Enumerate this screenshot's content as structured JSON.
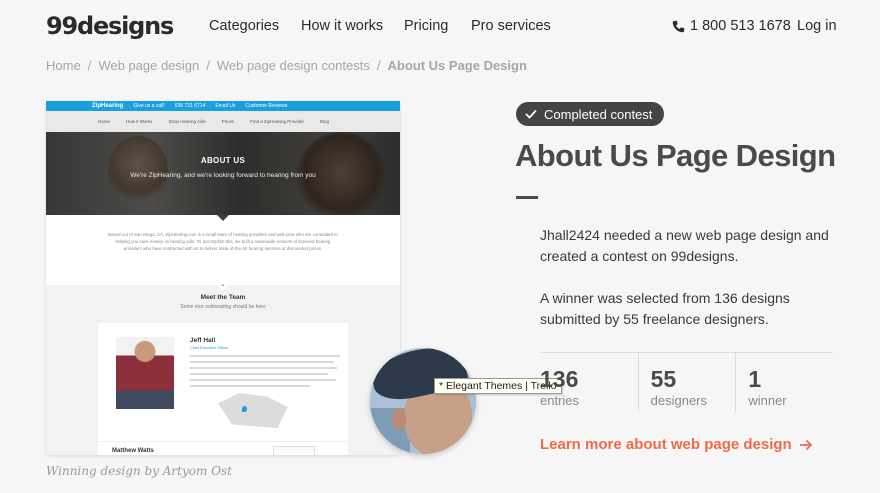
{
  "header": {
    "logo": "99designs",
    "nav": [
      "Categories",
      "How it works",
      "Pricing",
      "Pro services"
    ],
    "phone": "1 800 513 1678",
    "login": "Log in"
  },
  "breadcrumb": [
    "Home",
    "Web page design",
    "Web page design contests",
    "About Us Page Design"
  ],
  "preview": {
    "brand": "ZipHearing",
    "topbar": [
      "Give us a call!",
      "636 721 6714",
      "Email Us",
      "Customer Reviews"
    ],
    "nav": [
      "Home",
      "How it Works",
      "Shop Hearing Aids",
      "Prices",
      "Find a ZipHearing Provider",
      "Blog"
    ],
    "hero_title": "ABOUT US",
    "hero_subtitle": "We're ZipHearing, and we're looking forward to hearing from you",
    "intro": "Based out of San Diego, CA, ZipHearing.com is a small team of hearing providers and web pros who are committed to helping you save money on hearing aids. To accomplish this, we built a nationwide network of licensed hearing providers who have contracted with us to deliver state-of-the-art hearing services at discounted prices.",
    "team_title": "Meet the Team",
    "team_subtitle": "Some nice subheading should be here",
    "member_name": "Jeff Hall",
    "member_role": "Chief Executive Officer",
    "member2_name": "Matthew Watts"
  },
  "caption": "Winning design by Artyom Ost",
  "tooltip": "* Elegant Themes | Trello",
  "contest": {
    "badge": "Completed contest",
    "title": "About Us Page Design",
    "description_1": "Jhall2424 needed a new web page design and created a contest on 99designs.",
    "description_2": "A winner was selected from 136 designs submitted by 55 freelance designers.",
    "stats": [
      {
        "value": "136",
        "label": "entries"
      },
      {
        "value": "55",
        "label": "designers"
      },
      {
        "value": "1",
        "label": "winner"
      }
    ],
    "learn_more": "Learn more about web page design"
  },
  "colors": {
    "accent": "#ef6b4a",
    "badge_bg": "#444444",
    "preview_brand": "#1aa0dc"
  }
}
